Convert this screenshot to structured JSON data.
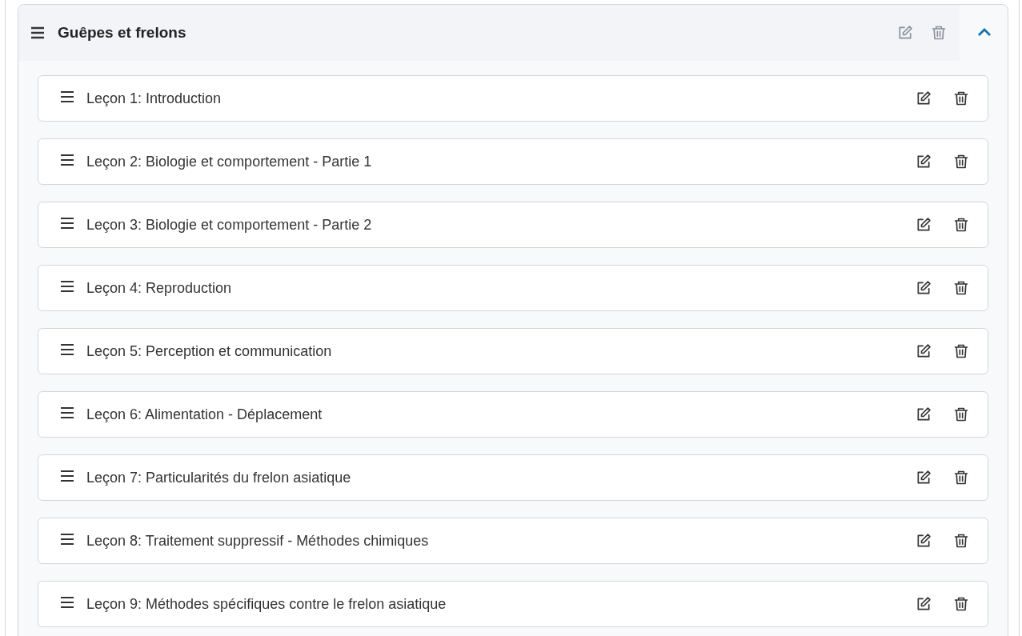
{
  "section": {
    "title": "Guêpes et frelons",
    "expanded": true
  },
  "lessons": [
    {
      "title": "Leçon 1: Introduction"
    },
    {
      "title": "Leçon 2: Biologie et comportement - Partie 1"
    },
    {
      "title": "Leçon 3: Biologie et comportement - Partie 2"
    },
    {
      "title": "Leçon 4: Reproduction"
    },
    {
      "title": "Leçon 5: Perception et communication"
    },
    {
      "title": "Leçon 6: Alimentation - Déplacement"
    },
    {
      "title": "Leçon 7: Particularités du frelon asiatique"
    },
    {
      "title": "Leçon 8: Traitement suppressif - Méthodes chimiques"
    },
    {
      "title": "Leçon 9: Méthodes spécifiques contre le frelon asiatique"
    }
  ]
}
